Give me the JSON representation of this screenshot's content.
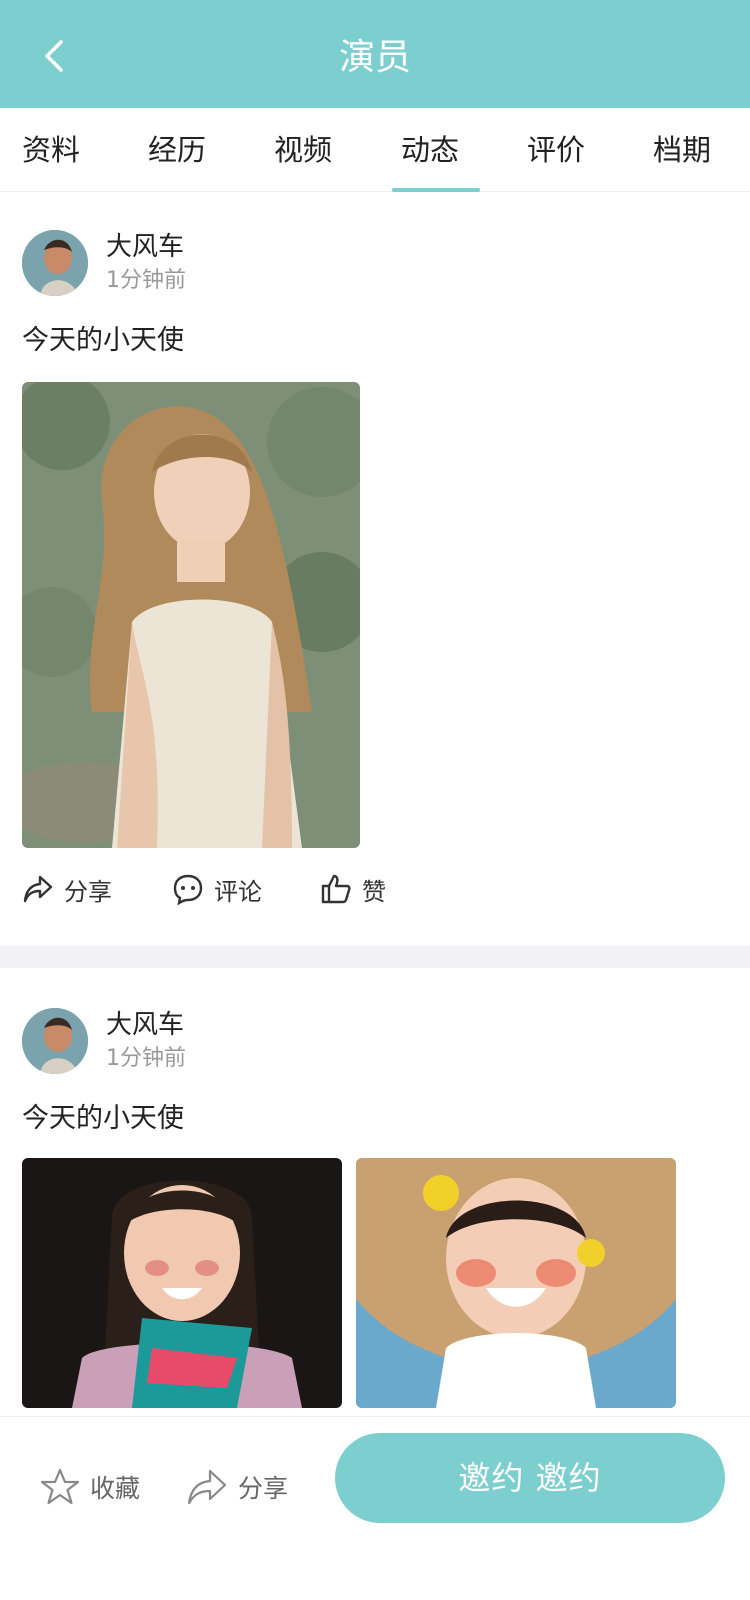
{
  "header": {
    "title": "演员",
    "back_icon": "chevron-left-icon"
  },
  "tabs": [
    {
      "label": "资料"
    },
    {
      "label": "经历"
    },
    {
      "label": "视频"
    },
    {
      "label": "动态"
    },
    {
      "label": "评价"
    },
    {
      "label": "档期"
    }
  ],
  "active_tab": "动态",
  "posts": [
    {
      "author": "大风车",
      "time": "1分钟前",
      "text": "今天的小天使",
      "actions": {
        "share": "分享",
        "comment": "评论",
        "like": "赞"
      }
    },
    {
      "author": "大风车",
      "time": "1分钟前",
      "text": "今天的小天使"
    }
  ],
  "bottom_bar": {
    "favorite": "收藏",
    "share": "分享",
    "invite": "邀约 邀约"
  },
  "colors": {
    "accent": "#7dcfcf",
    "separator": "#f2f2f6"
  }
}
